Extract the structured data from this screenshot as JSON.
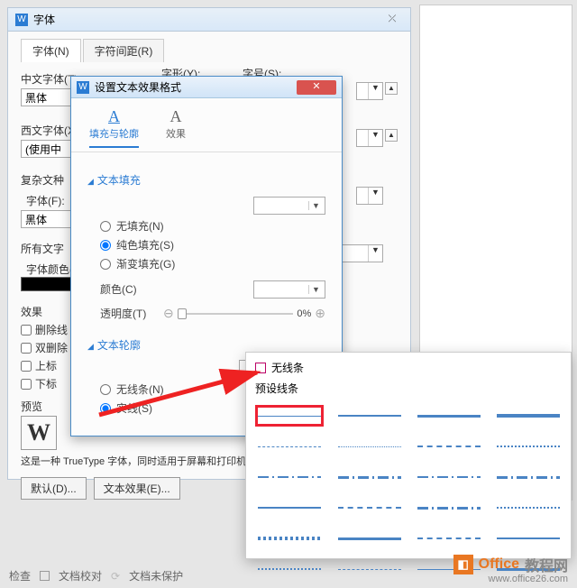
{
  "font_dialog": {
    "title": "字体",
    "close_glyph": "⤫",
    "tab_font": "字体(N)",
    "tab_spacing": "字符间距(R)",
    "cn_font_label": "中文字体(T):",
    "cn_font_value": "黑体",
    "shape_label": "字形(Y):",
    "size_label": "字号(S):",
    "wn_font_label": "西文字体(X):",
    "wn_font_value": "(使用中",
    "complex_label": "复杂文种",
    "font_f_label": "字体(F):",
    "font_f_value": "黑体",
    "all_label": "所有文字",
    "font_color_label": "字体颜色(C):",
    "effects_label": "效果",
    "strike_label": "删除线",
    "dbl_strike_label": "双删除",
    "super_label": "上标",
    "sub_label": "下标",
    "preview_label": "预览",
    "preview_text": "W",
    "note": "这是一种 TrueType 字体，同时适用于屏幕和打印机。",
    "default_btn": "默认(D)...",
    "text_effect_btn": "文本效果(E)..."
  },
  "text_effect": {
    "title": "设置文本效果格式",
    "tab_fill_outline": "填充与轮廓",
    "tab_effects": "效果",
    "section_fill": "文本填充",
    "no_fill": "无填充(N)",
    "solid_fill": "纯色填充(S)",
    "gradient_fill": "渐变填充(G)",
    "color_label": "颜色(C)",
    "opacity_label": "透明度(T)",
    "opacity_val": "0%",
    "section_outline": "文本轮廓",
    "no_line": "无线条(N)",
    "solid_line": "实线(S)"
  },
  "line_flyout": {
    "no_line": "无线条",
    "preset": "预设线条"
  },
  "status": {
    "check": "检查",
    "proof": "文档校对",
    "unsaved": "文档未保护"
  },
  "watermark": {
    "brand1": "Office",
    "brand2": "教程网",
    "url": "www.office26.com"
  }
}
